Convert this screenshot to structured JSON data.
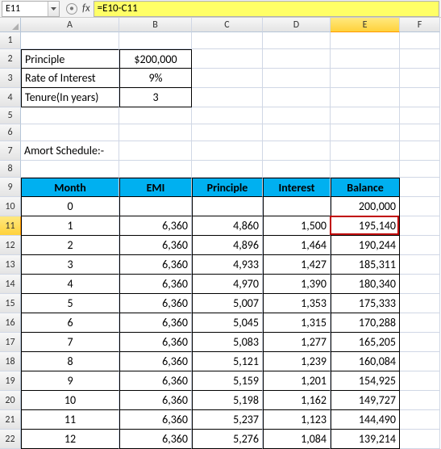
{
  "nameBox": "E11",
  "formula": "=E10-C11",
  "colHeaders": [
    "A",
    "B",
    "C",
    "D",
    "E",
    "F"
  ],
  "params": {
    "principleLabel": "Principle",
    "principleValue": "$200,000",
    "rateLabel": "Rate of Interest",
    "rateValue": "9%",
    "tenureLabel": "Tenure(In years)",
    "tenureValue": "3"
  },
  "scheduleTitle": "Amort Schedule:-",
  "tableHeaders": {
    "month": "Month",
    "emi": "EMI",
    "principle": "Principle",
    "interest": "Interest",
    "balance": "Balance"
  },
  "rows": [
    {
      "rn": "10",
      "month": "0",
      "emi": "",
      "principle": "",
      "interest": "",
      "balance": "200,000"
    },
    {
      "rn": "11",
      "month": "1",
      "emi": "6,360",
      "principle": "4,860",
      "interest": "1,500",
      "balance": "195,140"
    },
    {
      "rn": "12",
      "month": "2",
      "emi": "6,360",
      "principle": "4,896",
      "interest": "1,464",
      "balance": "190,244"
    },
    {
      "rn": "13",
      "month": "3",
      "emi": "6,360",
      "principle": "4,933",
      "interest": "1,427",
      "balance": "185,311"
    },
    {
      "rn": "14",
      "month": "4",
      "emi": "6,360",
      "principle": "4,970",
      "interest": "1,390",
      "balance": "180,340"
    },
    {
      "rn": "15",
      "month": "5",
      "emi": "6,360",
      "principle": "5,007",
      "interest": "1,353",
      "balance": "175,333"
    },
    {
      "rn": "16",
      "month": "6",
      "emi": "6,360",
      "principle": "5,045",
      "interest": "1,315",
      "balance": "170,288"
    },
    {
      "rn": "17",
      "month": "7",
      "emi": "6,360",
      "principle": "5,083",
      "interest": "1,277",
      "balance": "165,205"
    },
    {
      "rn": "18",
      "month": "8",
      "emi": "6,360",
      "principle": "5,121",
      "interest": "1,239",
      "balance": "160,084"
    },
    {
      "rn": "19",
      "month": "9",
      "emi": "6,360",
      "principle": "5,159",
      "interest": "1,201",
      "balance": "154,925"
    },
    {
      "rn": "20",
      "month": "10",
      "emi": "6,360",
      "principle": "5,198",
      "interest": "1,162",
      "balance": "149,727"
    },
    {
      "rn": "21",
      "month": "11",
      "emi": "6,360",
      "principle": "5,237",
      "interest": "1,123",
      "balance": "144,490"
    },
    {
      "rn": "22",
      "month": "12",
      "emi": "6,360",
      "principle": "5,276",
      "interest": "1,084",
      "balance": "139,214"
    }
  ],
  "activeCell": {
    "row": 11,
    "col": "E"
  }
}
